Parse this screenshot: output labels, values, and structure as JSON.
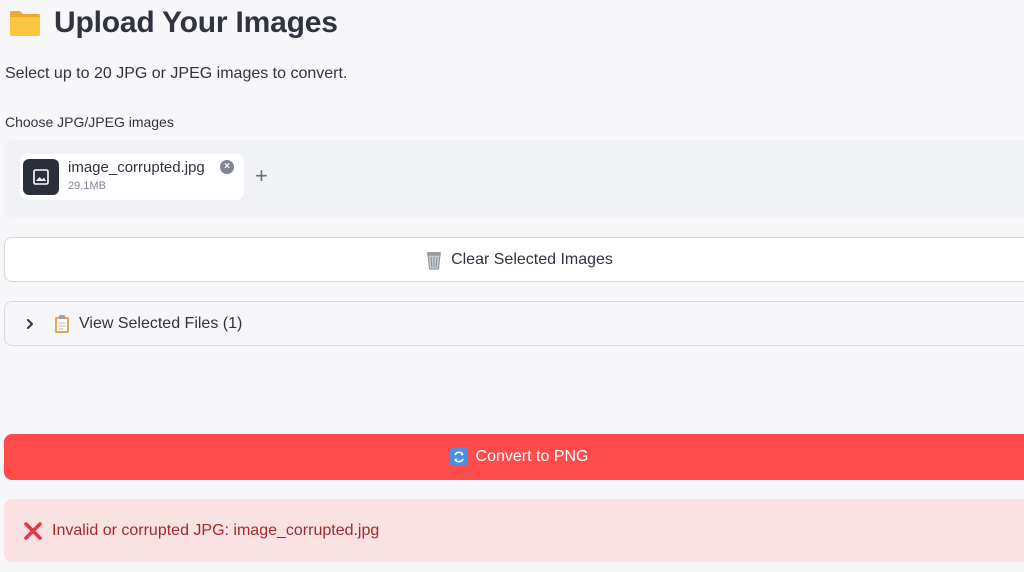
{
  "header": {
    "icon": "folder-icon",
    "title": "Upload Your Images"
  },
  "subtitle": "Select up to 20 JPG or JPEG images to convert.",
  "uploader": {
    "label": "Choose JPG/JPEG images",
    "files": [
      {
        "name": "image_corrupted.jpg",
        "size": "29.1MB",
        "icon": "image-icon"
      }
    ],
    "remove_symbol": "×",
    "add_symbol": "+"
  },
  "clear_button": {
    "icon": "wastebasket-icon",
    "label": "Clear Selected Images"
  },
  "expander": {
    "icon": "clipboard-icon",
    "label": "View Selected Files (1)"
  },
  "convert_button": {
    "icon": "refresh-icon",
    "label": "Convert to PNG"
  },
  "error_alert": {
    "icon": "cross-mark-icon",
    "message": "Invalid or corrupted JPG: image_corrupted.jpg"
  },
  "colors": {
    "primary": "#ff4b4b",
    "error_bg": "#fbe2e2",
    "error_text": "#a32a2a",
    "uploader_bg": "#f0f2f6"
  }
}
